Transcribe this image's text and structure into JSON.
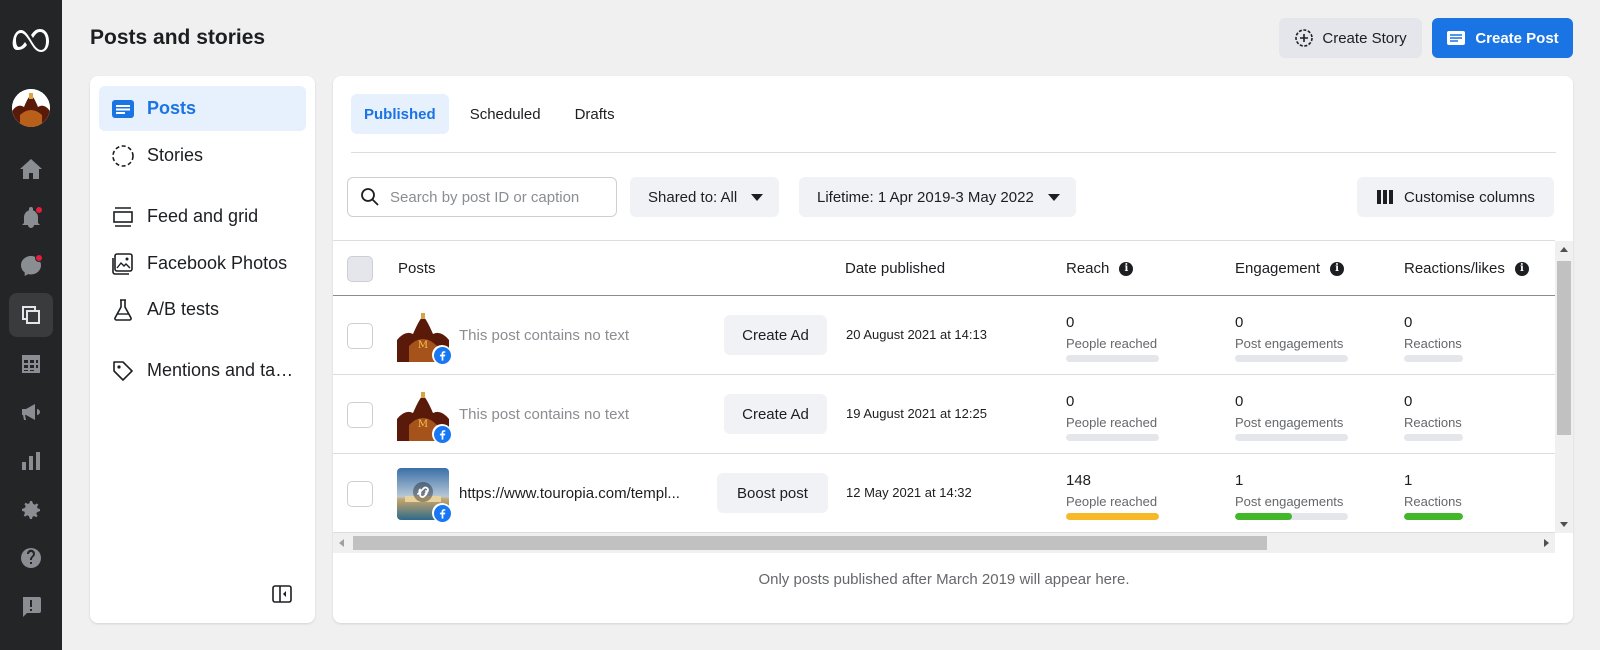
{
  "header": {
    "title": "Posts and stories",
    "create_story_label": "Create Story",
    "create_post_label": "Create Post"
  },
  "rail": {
    "icons": [
      "meta-logo-icon",
      "avatar",
      "home-icon",
      "notifications-icon",
      "inbox-icon",
      "posts-icon",
      "planner-icon",
      "ads-icon",
      "insights-icon",
      "settings-icon",
      "help-icon",
      "report-icon"
    ],
    "active": "posts-icon"
  },
  "sidebar": {
    "items": [
      {
        "label": "Posts",
        "icon": "posts-icon",
        "active": true
      },
      {
        "label": "Stories",
        "icon": "stories-icon",
        "active": false
      },
      {
        "label": "Feed and grid",
        "icon": "feed-grid-icon",
        "active": false
      },
      {
        "label": "Facebook Photos",
        "icon": "photos-icon",
        "active": false
      },
      {
        "label": "A/B tests",
        "icon": "flask-icon",
        "active": false
      },
      {
        "label": "Mentions and ta…",
        "icon": "tag-icon",
        "active": false
      }
    ]
  },
  "tabs": [
    {
      "label": "Published",
      "active": true
    },
    {
      "label": "Scheduled",
      "active": false
    },
    {
      "label": "Drafts",
      "active": false
    }
  ],
  "filters": {
    "search_placeholder": "Search by post ID or caption",
    "shared_to": "Shared to: All",
    "date_range": "Lifetime: 1 Apr 2019-3 May 2022",
    "customise_label": "Customise columns"
  },
  "table": {
    "columns": [
      "Posts",
      "Date published",
      "Reach",
      "Engagement",
      "Reactions/likes"
    ],
    "rows": [
      {
        "text": "This post contains no text",
        "action": "Create Ad",
        "date": "20 August 2021 at 14:13",
        "reach": "0",
        "reach_label": "People reached",
        "reach_fill": 0,
        "engagement": "0",
        "engagement_label": "Post engagements",
        "engagement_fill": 0,
        "reactions": "0",
        "reactions_label": "Reactions",
        "reactions_fill": 0
      },
      {
        "text": "This post contains no text",
        "action": "Create Ad",
        "date": "19 August 2021 at 12:25",
        "reach": "0",
        "reach_label": "People reached",
        "reach_fill": 0,
        "engagement": "0",
        "engagement_label": "Post engagements",
        "engagement_fill": 0,
        "reactions": "0",
        "reactions_label": "Reactions",
        "reactions_fill": 0
      },
      {
        "text": "https://www.touropia.com/templ...",
        "action": "Boost post",
        "date": "12 May 2021 at 14:32",
        "reach": "148",
        "reach_label": "People reached",
        "reach_fill": 1.0,
        "engagement": "1",
        "engagement_label": "Post engagements",
        "engagement_fill": 0.5,
        "reactions": "1",
        "reactions_label": "Reactions",
        "reactions_fill": 1.0
      }
    ]
  },
  "footnote": "Only posts published after March 2019 will appear here.",
  "colors": {
    "accent": "#1b74e4",
    "reach_bar": "#f7b928",
    "engagement_bar": "#42b72a",
    "reactions_bar": "#42b72a",
    "rail_bg": "#242526"
  }
}
